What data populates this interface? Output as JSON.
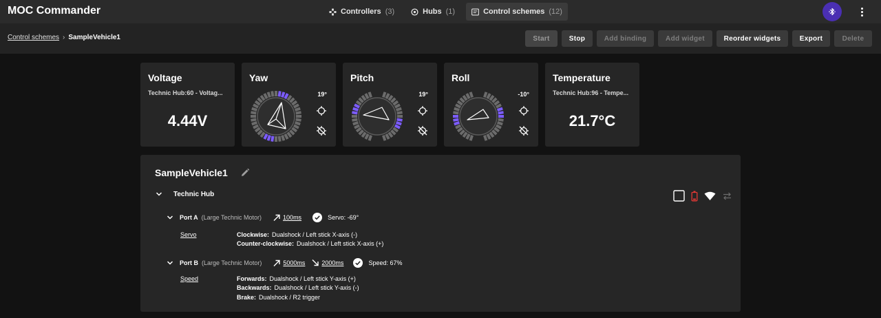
{
  "app": {
    "title": "MOC Commander"
  },
  "nav": {
    "tabs": [
      {
        "label": "Controllers",
        "count": "(3)",
        "icon": "controllers-icon",
        "active": false
      },
      {
        "label": "Hubs",
        "count": "(1)",
        "icon": "hubs-icon",
        "active": false
      },
      {
        "label": "Control schemes",
        "count": "(12)",
        "icon": "control-schemes-icon",
        "active": true
      }
    ],
    "bluetooth_icon": "bluetooth-icon",
    "menu_icon": "more-vert-icon"
  },
  "breadcrumb": {
    "parent": "Control schemes",
    "current": "SampleVehicle1"
  },
  "toolbar": {
    "start": "Start",
    "stop": "Stop",
    "add_binding": "Add binding",
    "add_widget": "Add widget",
    "reorder_widgets": "Reorder widgets",
    "export": "Export",
    "delete": "Delete"
  },
  "widgets": {
    "voltage": {
      "title": "Voltage",
      "subtitle": "Technic Hub:60 - Voltag...",
      "value": "4.44V"
    },
    "yaw": {
      "title": "Yaw",
      "angle": "19°"
    },
    "pitch": {
      "title": "Pitch",
      "angle": "19°"
    },
    "roll": {
      "title": "Roll",
      "angle": "-10°"
    },
    "temperature": {
      "title": "Temperature",
      "subtitle": "Technic Hub:96 - Tempe...",
      "value": "21.7°C"
    }
  },
  "scheme": {
    "name": "SampleVehicle1",
    "hub": {
      "name": "Technic Hub",
      "ports": [
        {
          "name": "Port A",
          "type": "(Large Technic Motor)",
          "acc": "100ms",
          "state": "Servo: -69°",
          "binding": "Servo",
          "inputs": [
            {
              "label": "Clockwise:",
              "value": "Dualshock / Left stick X-axis (-)"
            },
            {
              "label": "Counter-clockwise:",
              "value": "Dualshock / Left stick X-axis (+)"
            }
          ]
        },
        {
          "name": "Port B",
          "type": "(Large Technic Motor)",
          "acc": "5000ms",
          "dec": "2000ms",
          "state": "Speed: 67%",
          "binding": "Speed",
          "inputs": [
            {
              "label": "Forwards:",
              "value": "Dualshock / Left stick Y-axis (+)"
            },
            {
              "label": "Backwards:",
              "value": "Dualshock / Left stick Y-axis (-)"
            },
            {
              "label": "Brake:",
              "value": "Dualshock / R2 trigger"
            }
          ]
        }
      ]
    }
  },
  "colors": {
    "accent": "#4a2fb3",
    "gauge_tick": "#7c5cff",
    "battery": "#e53935"
  }
}
